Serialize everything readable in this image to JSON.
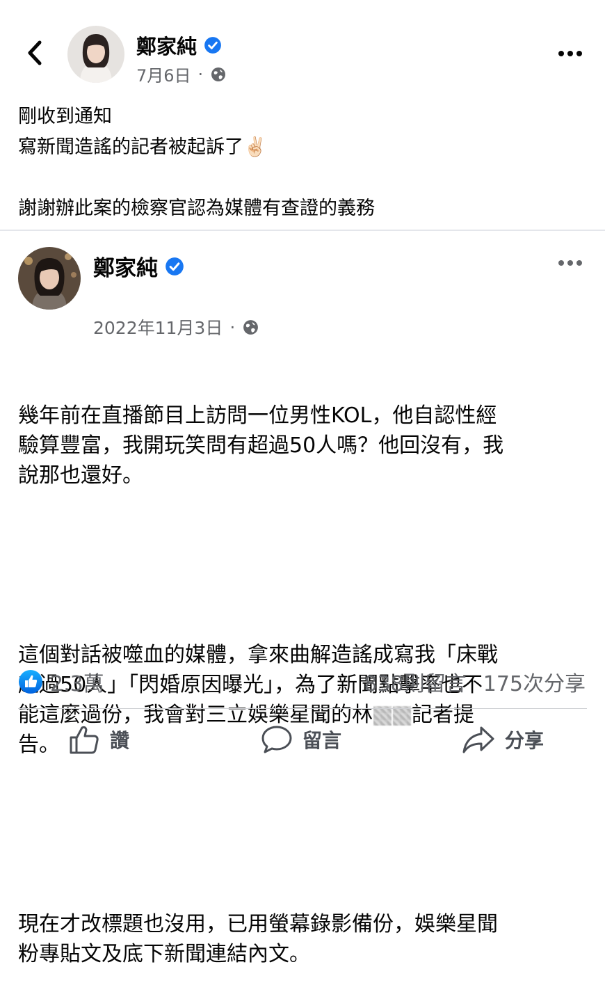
{
  "header": {
    "author_name": "鄭家純",
    "date": "7月6日",
    "separator": "·"
  },
  "post": {
    "lines": [
      "剛收到通知",
      "寫新聞造謠的記者被起訴了✌🏻",
      "",
      "謝謝辦此案的檢察官認為媒體有查證的義務"
    ]
  },
  "shared": {
    "author_name": "鄭家純",
    "date": "2022年11月3日",
    "separator": "·",
    "paragraph1": "幾年前在直播節目上訪問一位男性KOL，他自認性經\n驗算豐富，我開玩笑問有超過50人嗎？他回沒有，我\n說那也還好。",
    "paragraph2_before": "這個對話被噬血的媒體，拿來曲解造謠成寫我「床戰\n超過50人」「閃婚原因曝光」，為了新聞點擊率也不\n能這麼過份，我會對三立娛樂星聞的林",
    "paragraph2_after": "記者提\n告。",
    "paragraph3": "現在才改標題也沒用，已用螢幕錄影備份，娛樂星聞\n粉專貼文及底下新聞連結內文。"
  },
  "stats": {
    "likes": "2.3萬",
    "comments": "838則留言",
    "shares": "175次分享"
  },
  "actions": {
    "like": "讚",
    "comment": "留言",
    "share": "分享"
  },
  "icons": {
    "back": "chevron-left-icon",
    "more": "ellipsis-icon",
    "verified": "verified-badge-icon",
    "globe": "globe-icon",
    "like_reaction": "like-reaction-icon",
    "thumb": "thumbs-up-icon",
    "comment": "comment-bubble-icon",
    "share": "share-arrow-icon"
  },
  "colors": {
    "verified_blue": "#1877f2",
    "secondary_text": "#65676b"
  }
}
